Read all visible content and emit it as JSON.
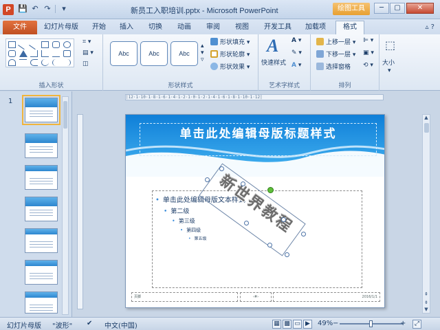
{
  "window": {
    "title": "新员工入职培训.pptx - Microsoft PowerPoint",
    "contextual_tools": "绘图工具",
    "minimize": "─",
    "maximize": "▢",
    "close": "✕"
  },
  "quick_access": [
    "save-icon",
    "undo-icon",
    "redo-icon"
  ],
  "tabs": {
    "file": "文件",
    "items": [
      "幻灯片母版",
      "开始",
      "插入",
      "切换",
      "动画",
      "审阅",
      "视图",
      "开发工具",
      "加载项",
      "格式"
    ],
    "active": "格式"
  },
  "ribbon": {
    "groups": {
      "insert_shapes": "插入形状",
      "shape_styles": "形状样式",
      "wordart_styles": "艺术字样式",
      "arrange": "排列"
    },
    "style_samples": [
      "Abc",
      "Abc",
      "Abc"
    ],
    "shape_fill": "形状填充",
    "shape_outline": "形状轮廓",
    "shape_effects": "形状效果",
    "quick_styles": "快速样式",
    "bring_forward": "上移一层",
    "send_backward": "下移一层",
    "selection_pane": "选择窗格",
    "size": "大小"
  },
  "slides_pane": {
    "selected_number": "1",
    "count_visible": 7
  },
  "slide": {
    "title": "单击此处编辑母版标题样式",
    "levels": [
      "单击此处编辑母版文本样式",
      "第二级",
      "第三级",
      "第四级",
      "第五级"
    ],
    "footer_left": "页脚",
    "footer_mid": "‹#›",
    "footer_right": "2016/1/1",
    "watermark_text": "新世界教程"
  },
  "status": {
    "view": "幻灯片母版",
    "theme": "\"波形\"",
    "language": "中文(中国)",
    "zoom": "49%",
    "zoom_out": "−",
    "zoom_in": "+"
  },
  "colors": {
    "file_tab": "#c9542a",
    "accent": "#2d86cf",
    "contextual": "#e8a030"
  }
}
